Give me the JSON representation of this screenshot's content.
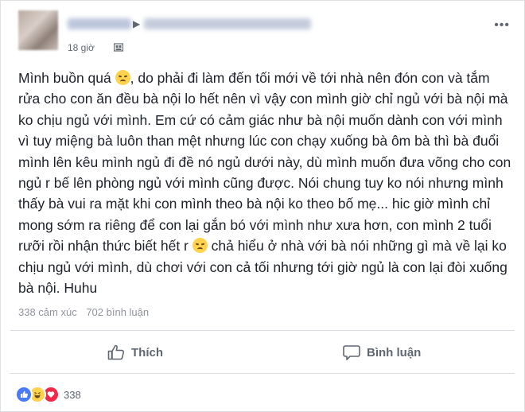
{
  "post": {
    "timestamp": "18 giờ",
    "more_label": "•••",
    "author_arrow": "▶",
    "content": "Mình buồn quá 😞, do phải đi làm đến tối mới về tới nhà nên đón con và tắm rửa cho con ăn đều bà nội lo hết nên vì vậy con mình giờ chỉ ngủ với bà nội mà ko chịu ngủ với mình. Em cứ có cảm giác như bà nội muốn dành con với mình vì tuy miệng bà luôn than mệt nhưng lúc con chạy xuống bà ôm bà thì bà đuổi mình lên kêu mình ngủ đi đề nó ngủ dưới này, dù mình muốn đưa võng cho con ngủ r bế lên phòng ngủ với mình cũng được. Nói chung tuy ko nói nhưng mình thấy bà vui ra mặt khi con mình theo bà nội ko theo bố mẹ... hic giờ mình chỉ mong sớm ra riêng để con lại gắn bó với mình như xưa hơn, con mình 2 tuổi rưỡi rồi nhận thức biết hết r 😞 chả hiểu ở nhà với bà nói những gì mà về lại ko chịu ngủ với mình, dù chơi với con cả tối nhưng tới giờ ngủ là con lại đòi xuống bà nội. Huhu",
    "content_parts": [
      "Mình buồn quá ",
      ", do phải đi làm đến tối mới về tới nhà nên đón con và tắm rửa cho con ăn đều bà nội lo hết nên vì vậy con mình giờ chỉ ngủ với bà nội mà ko chịu ngủ với mình. Em cứ có cảm giác như bà nội muốn dành con với mình vì tuy miệng bà luôn than mệt nhưng lúc con chạy xuống bà ôm bà thì bà đuổi mình lên kêu mình ngủ đi đề nó ngủ dưới này, dù mình muốn đưa võng cho con ngủ r bế lên phòng ngủ với mình cũng được. Nói chung tuy ko nói nhưng mình thấy bà vui ra mặt khi con mình theo bà nội ko theo bố mẹ... hic giờ mình chỉ mong sớm ra riêng để con lại gắn bó với mình như xưa hơn, con mình 2 tuổi rưỡi rồi nhận thức biết hết r ",
      " chả hiểu ở nhà với bà nói những gì mà về lại ko chịu ngủ với mình, dù chơi với con cả tối nhưng tới giờ ngủ là con lại đòi xuống bà nội. Huhu"
    ],
    "emoji_name": "disappointed-face"
  },
  "stats": {
    "reactions_label": "338 cảm xúc",
    "comments_label": "702 bình luận"
  },
  "actions": {
    "like_label": "Thích",
    "comment_label": "Bình luận"
  },
  "reactions_bar": {
    "count": "338",
    "icons": [
      "like-icon",
      "haha-icon",
      "love-icon"
    ]
  },
  "colors": {
    "like_blue": "#4a7bf7",
    "love_red": "#f0284a",
    "emoji_yellow": "#ffd34e",
    "muted_text": "#90949c"
  }
}
